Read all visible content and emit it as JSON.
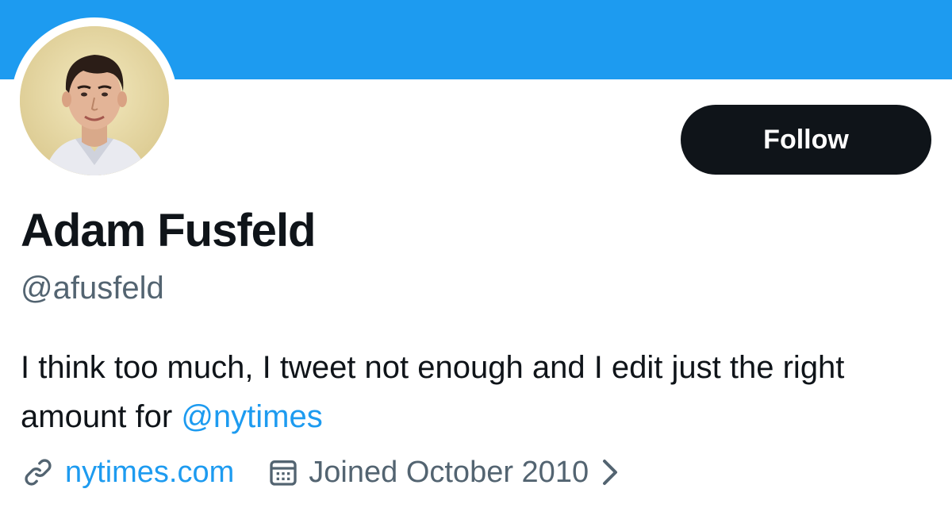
{
  "theme": {
    "banner_color": "#1d9bf0",
    "accent": "#1d9bf0",
    "button_bg": "#0f1419",
    "text_primary": "#0f1419",
    "text_secondary": "#536471"
  },
  "profile": {
    "avatar_icon": "profile-photo",
    "display_name": "Adam Fusfeld",
    "handle": "@afusfeld",
    "bio_text": "I think too much, I tweet not enough and I edit just the right amount for ",
    "bio_mention": "@nytimes"
  },
  "actions": {
    "follow_label": "Follow"
  },
  "meta": {
    "link_icon": "link-icon",
    "website": "nytimes.com",
    "calendar_icon": "calendar-icon",
    "joined": "Joined October 2010",
    "chevron_icon": "chevron-right-icon"
  }
}
